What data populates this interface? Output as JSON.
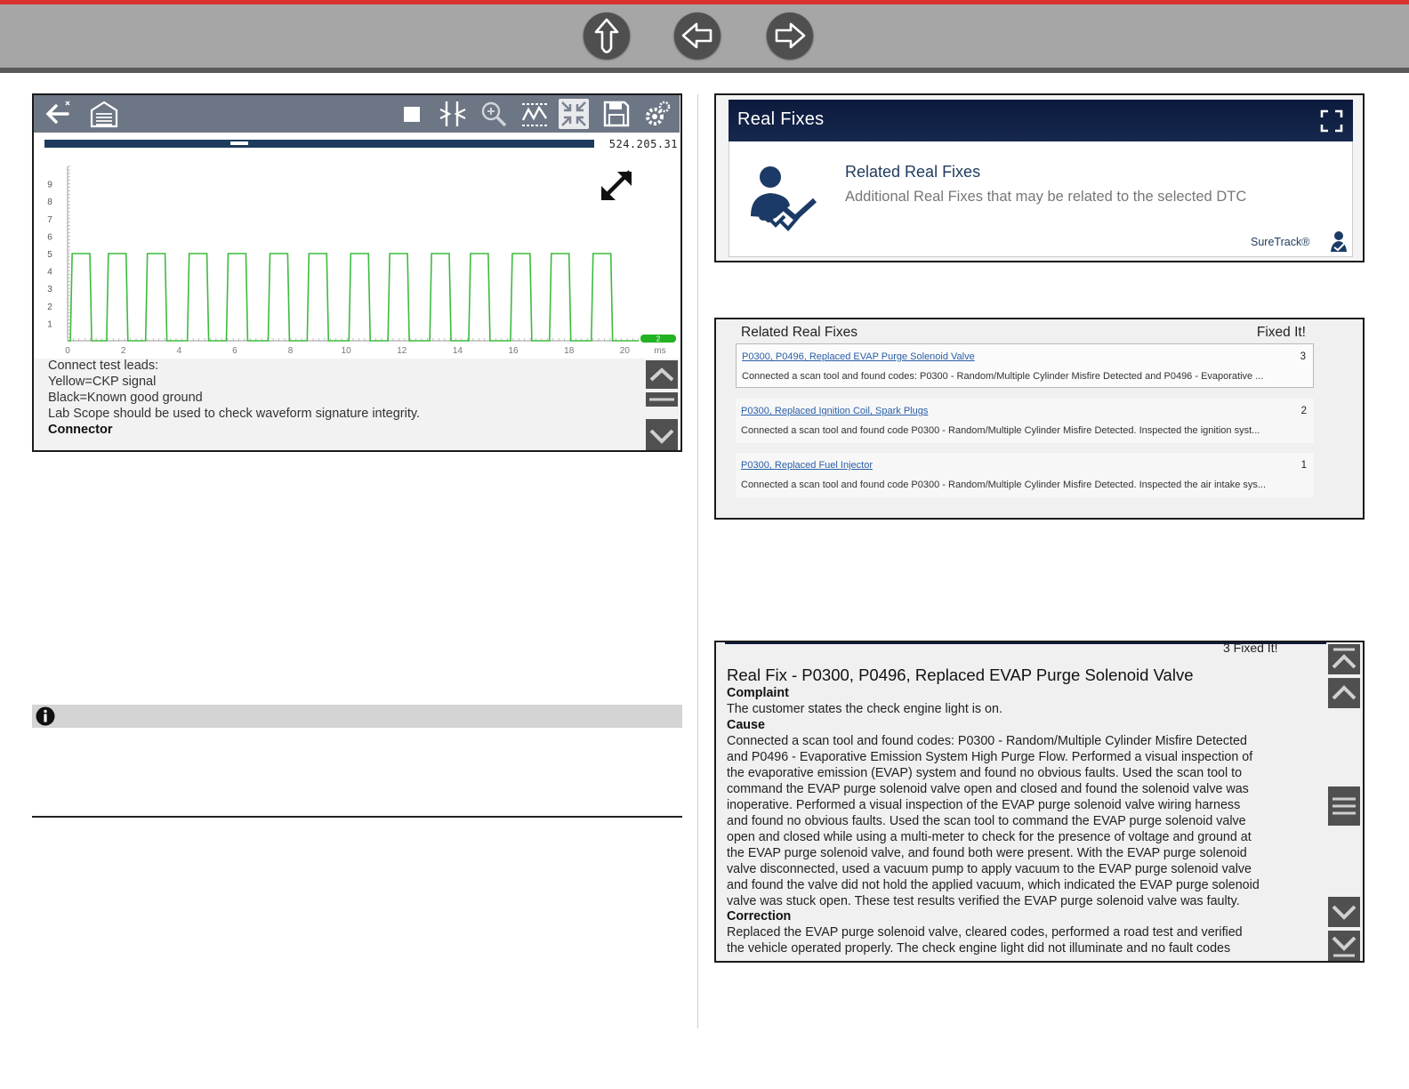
{
  "nav": {
    "buttons": [
      {
        "name": "up-arrow-icon"
      },
      {
        "name": "back-arrow-icon"
      },
      {
        "name": "forward-arrow-icon"
      }
    ]
  },
  "scope": {
    "toolbar_icons": [
      "back-icon",
      "home-icon",
      "stop-icon",
      "cursor-icon",
      "zoom-icon",
      "trace-icon",
      "fullscreen-icon",
      "save-icon",
      "settings-icon"
    ],
    "position_value": "524.205.31",
    "progress": 0.35,
    "trace_color": "#3dbb3d",
    "marker_label": "2",
    "info_lines": [
      "Connect test leads:",
      "Yellow=CKP signal",
      "Black=Known good ground",
      "Lab Scope should be used to check waveform signature integrity.",
      "Connector"
    ],
    "chart_data": {
      "type": "line",
      "x_ticks": [
        "0",
        "2",
        "4",
        "6",
        "8",
        "10",
        "12",
        "14",
        "16",
        "18",
        "20"
      ],
      "x_unit": "ms",
      "y_ticks": [
        "1",
        "2",
        "3",
        "4",
        "5",
        "6",
        "7",
        "8",
        "9"
      ],
      "xlim": [
        0,
        20.5
      ],
      "ylim": [
        0,
        10
      ],
      "series": [
        {
          "signal": "square",
          "low": 0,
          "high": 5,
          "pulses": [
            [
              0.1,
              0.8
            ],
            [
              1.4,
              2.1
            ],
            [
              2.8,
              3.5
            ],
            [
              4.3,
              5.0
            ],
            [
              5.7,
              6.4
            ],
            [
              7.2,
              7.9
            ],
            [
              8.6,
              9.3
            ],
            [
              10.1,
              10.8
            ],
            [
              11.5,
              12.2
            ],
            [
              13.0,
              13.7
            ],
            [
              14.4,
              15.1
            ],
            [
              15.9,
              16.6
            ],
            [
              17.3,
              18.0
            ],
            [
              18.8,
              19.5
            ]
          ]
        }
      ]
    }
  },
  "real_fixes": {
    "title": "Real Fixes",
    "subtitle": "Related Real Fixes",
    "description": "Additional Real Fixes that may be related to the selected DTC",
    "brand": "SureTrack®"
  },
  "related_list": {
    "header_left": "Related Real Fixes",
    "header_right": "Fixed It!",
    "items": [
      {
        "title": "P0300, P0496, Replaced EVAP Purge Solenoid Valve",
        "count": "3",
        "desc": "Connected a scan tool and found codes: P0300 - Random/Multiple Cylinder Misfire Detected and P0496 - Evaporative ..."
      },
      {
        "title": "P0300, Replaced Ignition Coil, Spark Plugs",
        "count": "2",
        "desc": "Connected a scan tool and found code P0300 - Random/Multiple Cylinder Misfire Detected. Inspected the ignition syst..."
      },
      {
        "title": "P0300, Replaced Fuel Injector",
        "count": "1",
        "desc": "Connected a scan tool and found code P0300 - Random/Multiple Cylinder Misfire Detected. Inspected the air intake sys..."
      }
    ]
  },
  "real_fix_detail": {
    "top_cut": "3  Fixed It!",
    "title": "Real Fix - P0300, P0496, Replaced EVAP Purge Solenoid Valve",
    "complaint_label": "Complaint",
    "complaint": "The customer states the check engine light is on.",
    "cause_label": "Cause",
    "cause_lines": [
      "Connected a scan tool and found codes: P0300 - Random/Multiple Cylinder Misfire Detected",
      "and P0496 - Evaporative Emission System High Purge Flow. Performed a visual inspection of",
      "the evaporative emission (EVAP) system and found no obvious faults. Used the scan tool to",
      "command the EVAP purge solenoid valve open and closed and found the solenoid valve was",
      "inoperative. Performed a visual inspection of the EVAP purge solenoid valve wiring harness",
      "and found no obvious faults. Used the scan tool to command the EVAP purge solenoid valve",
      "open and closed while using a multi-meter to check for the presence of voltage and ground at",
      "the EVAP purge solenoid valve, and found both were present. With the EVAP purge solenoid",
      "valve disconnected, used a vacuum pump to apply vacuum to the EVAP purge solenoid valve",
      "and found the valve did not hold the applied vacuum, which indicated the EVAP purge solenoid",
      "valve was stuck open. These test results verified the EVAP purge solenoid valve was faulty."
    ],
    "correction_label": "Correction",
    "correction_lines": [
      "Replaced the EVAP purge solenoid valve, cleared codes, performed a road test and verified",
      "the vehicle operated properly. The check engine light did not illuminate and no fault codes"
    ]
  },
  "note": {
    "icon": "info-icon"
  }
}
